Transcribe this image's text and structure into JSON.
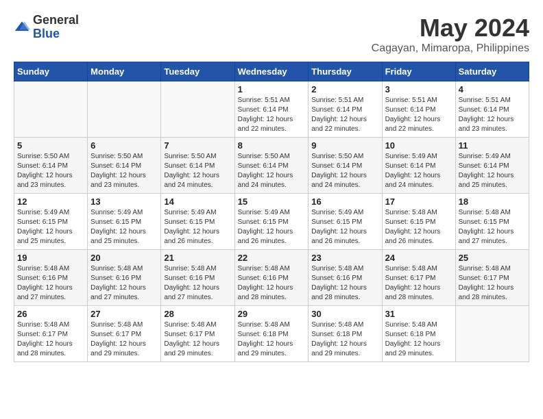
{
  "header": {
    "logo_general": "General",
    "logo_blue": "Blue",
    "month_title": "May 2024",
    "location": "Cagayan, Mimaropa, Philippines"
  },
  "days_of_week": [
    "Sunday",
    "Monday",
    "Tuesday",
    "Wednesday",
    "Thursday",
    "Friday",
    "Saturday"
  ],
  "weeks": [
    [
      {
        "day": "",
        "info": ""
      },
      {
        "day": "",
        "info": ""
      },
      {
        "day": "",
        "info": ""
      },
      {
        "day": "1",
        "info": "Sunrise: 5:51 AM\nSunset: 6:14 PM\nDaylight: 12 hours\nand 22 minutes."
      },
      {
        "day": "2",
        "info": "Sunrise: 5:51 AM\nSunset: 6:14 PM\nDaylight: 12 hours\nand 22 minutes."
      },
      {
        "day": "3",
        "info": "Sunrise: 5:51 AM\nSunset: 6:14 PM\nDaylight: 12 hours\nand 22 minutes."
      },
      {
        "day": "4",
        "info": "Sunrise: 5:51 AM\nSunset: 6:14 PM\nDaylight: 12 hours\nand 23 minutes."
      }
    ],
    [
      {
        "day": "5",
        "info": "Sunrise: 5:50 AM\nSunset: 6:14 PM\nDaylight: 12 hours\nand 23 minutes."
      },
      {
        "day": "6",
        "info": "Sunrise: 5:50 AM\nSunset: 6:14 PM\nDaylight: 12 hours\nand 23 minutes."
      },
      {
        "day": "7",
        "info": "Sunrise: 5:50 AM\nSunset: 6:14 PM\nDaylight: 12 hours\nand 24 minutes."
      },
      {
        "day": "8",
        "info": "Sunrise: 5:50 AM\nSunset: 6:14 PM\nDaylight: 12 hours\nand 24 minutes."
      },
      {
        "day": "9",
        "info": "Sunrise: 5:50 AM\nSunset: 6:14 PM\nDaylight: 12 hours\nand 24 minutes."
      },
      {
        "day": "10",
        "info": "Sunrise: 5:49 AM\nSunset: 6:14 PM\nDaylight: 12 hours\nand 24 minutes."
      },
      {
        "day": "11",
        "info": "Sunrise: 5:49 AM\nSunset: 6:14 PM\nDaylight: 12 hours\nand 25 minutes."
      }
    ],
    [
      {
        "day": "12",
        "info": "Sunrise: 5:49 AM\nSunset: 6:15 PM\nDaylight: 12 hours\nand 25 minutes."
      },
      {
        "day": "13",
        "info": "Sunrise: 5:49 AM\nSunset: 6:15 PM\nDaylight: 12 hours\nand 25 minutes."
      },
      {
        "day": "14",
        "info": "Sunrise: 5:49 AM\nSunset: 6:15 PM\nDaylight: 12 hours\nand 26 minutes."
      },
      {
        "day": "15",
        "info": "Sunrise: 5:49 AM\nSunset: 6:15 PM\nDaylight: 12 hours\nand 26 minutes."
      },
      {
        "day": "16",
        "info": "Sunrise: 5:49 AM\nSunset: 6:15 PM\nDaylight: 12 hours\nand 26 minutes."
      },
      {
        "day": "17",
        "info": "Sunrise: 5:48 AM\nSunset: 6:15 PM\nDaylight: 12 hours\nand 26 minutes."
      },
      {
        "day": "18",
        "info": "Sunrise: 5:48 AM\nSunset: 6:15 PM\nDaylight: 12 hours\nand 27 minutes."
      }
    ],
    [
      {
        "day": "19",
        "info": "Sunrise: 5:48 AM\nSunset: 6:16 PM\nDaylight: 12 hours\nand 27 minutes."
      },
      {
        "day": "20",
        "info": "Sunrise: 5:48 AM\nSunset: 6:16 PM\nDaylight: 12 hours\nand 27 minutes."
      },
      {
        "day": "21",
        "info": "Sunrise: 5:48 AM\nSunset: 6:16 PM\nDaylight: 12 hours\nand 27 minutes."
      },
      {
        "day": "22",
        "info": "Sunrise: 5:48 AM\nSunset: 6:16 PM\nDaylight: 12 hours\nand 28 minutes."
      },
      {
        "day": "23",
        "info": "Sunrise: 5:48 AM\nSunset: 6:16 PM\nDaylight: 12 hours\nand 28 minutes."
      },
      {
        "day": "24",
        "info": "Sunrise: 5:48 AM\nSunset: 6:17 PM\nDaylight: 12 hours\nand 28 minutes."
      },
      {
        "day": "25",
        "info": "Sunrise: 5:48 AM\nSunset: 6:17 PM\nDaylight: 12 hours\nand 28 minutes."
      }
    ],
    [
      {
        "day": "26",
        "info": "Sunrise: 5:48 AM\nSunset: 6:17 PM\nDaylight: 12 hours\nand 28 minutes."
      },
      {
        "day": "27",
        "info": "Sunrise: 5:48 AM\nSunset: 6:17 PM\nDaylight: 12 hours\nand 29 minutes."
      },
      {
        "day": "28",
        "info": "Sunrise: 5:48 AM\nSunset: 6:17 PM\nDaylight: 12 hours\nand 29 minutes."
      },
      {
        "day": "29",
        "info": "Sunrise: 5:48 AM\nSunset: 6:18 PM\nDaylight: 12 hours\nand 29 minutes."
      },
      {
        "day": "30",
        "info": "Sunrise: 5:48 AM\nSunset: 6:18 PM\nDaylight: 12 hours\nand 29 minutes."
      },
      {
        "day": "31",
        "info": "Sunrise: 5:48 AM\nSunset: 6:18 PM\nDaylight: 12 hours\nand 29 minutes."
      },
      {
        "day": "",
        "info": ""
      }
    ]
  ]
}
